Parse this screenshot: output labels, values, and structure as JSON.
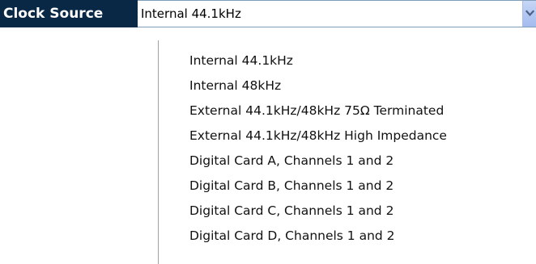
{
  "field": {
    "label": "Clock Source",
    "selected_value": "Internal 44.1kHz",
    "arrow_icon": "chevron-down-icon",
    "label_bg": "#082846",
    "arrow_bg": "#b3c8f2"
  },
  "options": [
    "Internal 44.1kHz",
    "Internal 48kHz",
    "External 44.1kHz/48kHz 75Ω Terminated",
    "External 44.1kHz/48kHz High Impedance",
    "Digital Card A, Channels 1 and 2",
    "Digital Card B, Channels 1 and 2",
    "Digital Card C, Channels 1 and 2",
    "Digital Card D, Channels 1 and 2"
  ]
}
